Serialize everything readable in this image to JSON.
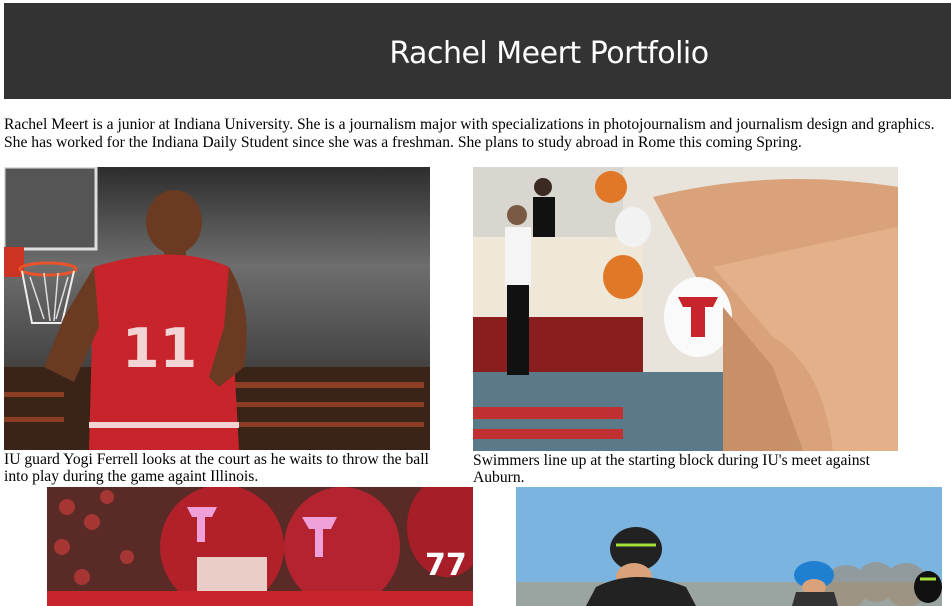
{
  "header": {
    "title": "Rachel Meert Portfolio"
  },
  "bio": {
    "text": "Rachel Meert is a junior at Indiana University. She is a journalism major with specializations in photojournalism and journalism design and graphics. She has worked for the Indiana Daily Student since she was a freshman. She plans to study abroad in Rome this coming Spring."
  },
  "gallery": [
    {
      "image_icon": "basketball-player-photo",
      "jersey_number": "11",
      "caption": "IU guard Yogi Ferrell looks at the court as he waits to throw the ball into play during the game againt Illinois."
    },
    {
      "image_icon": "swimmers-starting-block-photo",
      "caption": "Swimmers line up at the starting block during IU's meet against Auburn."
    },
    {
      "image_icon": "football-players-photo",
      "jersey_number": "77",
      "caption": ""
    },
    {
      "image_icon": "cyclists-race-photo",
      "caption": ""
    }
  ],
  "colors": {
    "header_bg": "#333333",
    "header_text": "#ffffff",
    "iu_crimson": "#9e1b24"
  }
}
